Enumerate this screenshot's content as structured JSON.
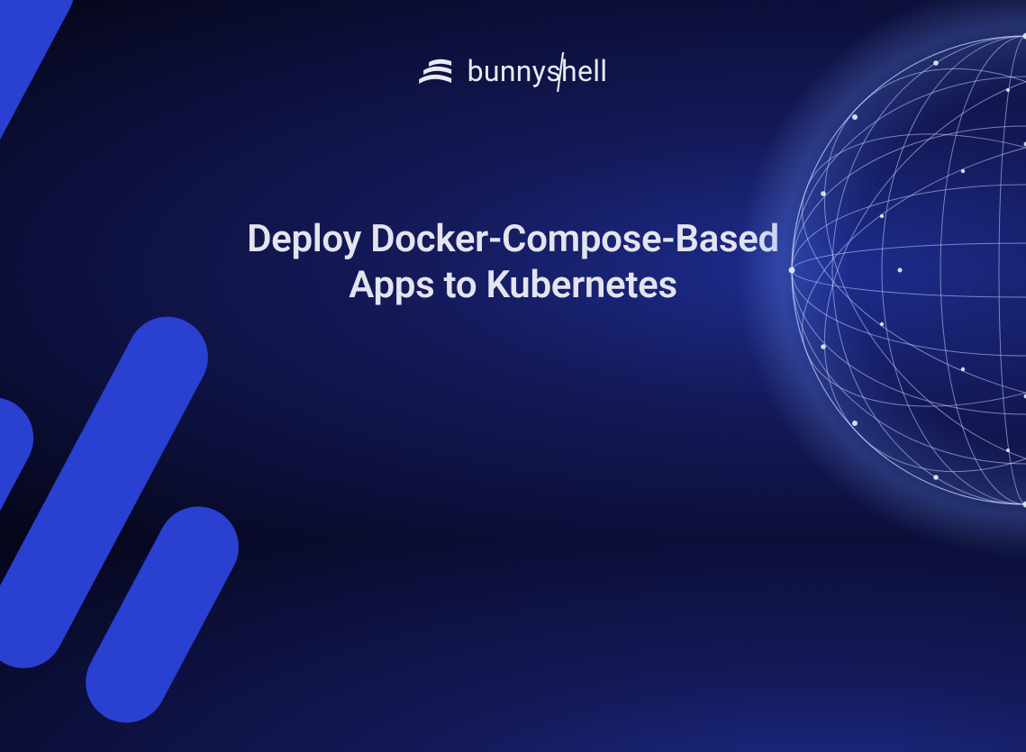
{
  "brand": {
    "name_left": "bunny",
    "name_right": "shell"
  },
  "headline": {
    "line1": "Deploy Docker-Compose-Based",
    "line2": "Apps to Kubernetes"
  },
  "colors": {
    "accent": "#2940d1",
    "bg_inner": "#1e2d8f",
    "bg_outer": "#050618",
    "text": "#e3e4ef"
  }
}
